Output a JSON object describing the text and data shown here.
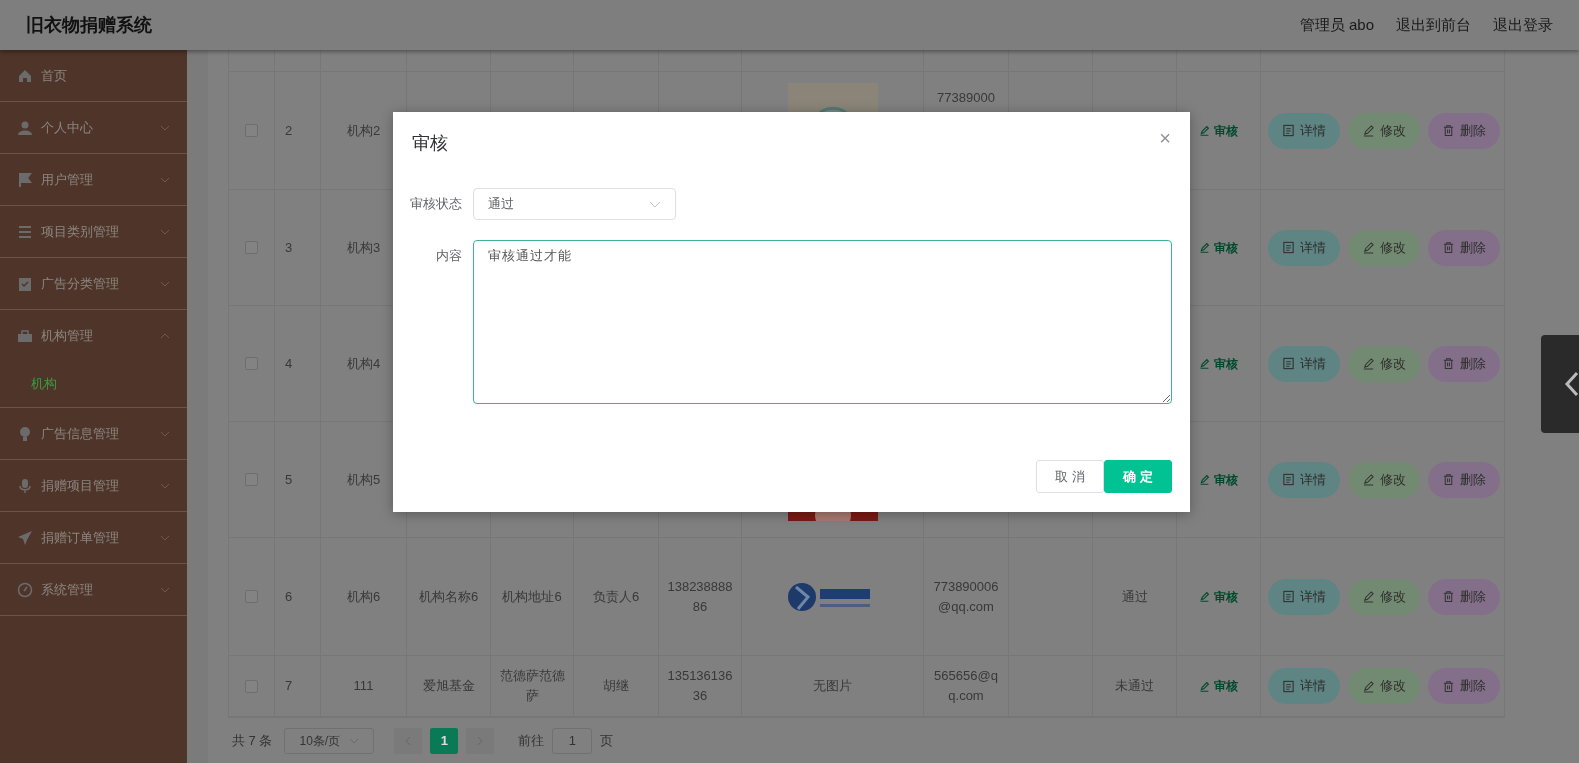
{
  "header": {
    "title": "旧衣物捐赠系统",
    "links": [
      "管理员 abo",
      "退出到前台",
      "退出登录"
    ]
  },
  "sidebar": {
    "items": [
      {
        "label": "首页"
      },
      {
        "label": "个人中心",
        "expanded": false
      },
      {
        "label": "用户管理",
        "expanded": false
      },
      {
        "label": "项目类别管理",
        "expanded": false
      },
      {
        "label": "广告分类管理",
        "expanded": false
      },
      {
        "label": "机构管理",
        "expanded": true,
        "children": [
          {
            "label": "机构",
            "selected": true
          }
        ]
      },
      {
        "label": "广告信息管理",
        "expanded": false
      },
      {
        "label": "捐赠项目管理",
        "expanded": false
      },
      {
        "label": "捐赠订单管理",
        "expanded": false
      },
      {
        "label": "系统管理",
        "expanded": false
      }
    ]
  },
  "table": {
    "rows": [
      {
        "checked": false,
        "cells": {
          "column_2": "2",
          "column_3": "机构2",
          "column_9": "77389000"
        },
        "audit": "审核",
        "buttons": [
          {
            "kind": "detail",
            "label": "详情"
          },
          {
            "kind": "edit",
            "label": "修改"
          },
          {
            "kind": "delete",
            "label": "删除"
          }
        ]
      },
      {
        "checked": false,
        "cells": {
          "column_2": "3",
          "column_3": "机构3"
        },
        "audit": "审核",
        "buttons": [
          {
            "kind": "detail",
            "label": "详情"
          },
          {
            "kind": "edit",
            "label": "修改"
          },
          {
            "kind": "delete",
            "label": "删除"
          }
        ]
      },
      {
        "checked": false,
        "cells": {
          "column_2": "4",
          "column_3": "机构4"
        },
        "audit": "审核",
        "buttons": [
          {
            "kind": "detail",
            "label": "详情"
          },
          {
            "kind": "edit",
            "label": "修改"
          },
          {
            "kind": "delete",
            "label": "删除"
          }
        ]
      },
      {
        "checked": false,
        "cells": {
          "column_2": "5",
          "column_3": "机构5"
        },
        "audit": "审核",
        "buttons": [
          {
            "kind": "detail",
            "label": "详情"
          },
          {
            "kind": "edit",
            "label": "修改"
          },
          {
            "kind": "delete",
            "label": "删除"
          }
        ]
      },
      {
        "checked": false,
        "cells": {
          "column_2": "6",
          "column_3": "机构6",
          "column_4": "机构名称6",
          "column_5": "机构地址6",
          "column_6": "负责人6",
          "column_7": "13823888886",
          "column_9": "773890006@qq.com",
          "column_11": "通过"
        },
        "audit": "审核",
        "buttons": [
          {
            "kind": "detail",
            "label": "详情"
          },
          {
            "kind": "edit",
            "label": "修改"
          },
          {
            "kind": "delete",
            "label": "删除"
          }
        ]
      },
      {
        "checked": false,
        "cells": {
          "column_2": "7",
          "column_3": "111",
          "column_4": "爱旭基金",
          "column_5": "范德萨范德萨",
          "column_6": "胡继",
          "column_7": "13513613636",
          "column_8": "无图片",
          "column_9": "565656@qq.com",
          "column_11": "未通过"
        },
        "audit": "审核",
        "buttons": [
          {
            "kind": "detail",
            "label": "详情"
          },
          {
            "kind": "edit",
            "label": "修改"
          },
          {
            "kind": "delete",
            "label": "删除"
          }
        ]
      }
    ]
  },
  "pagination": {
    "total": "共 7 条",
    "page_size": "10条/页",
    "pages": [
      {
        "label": "1",
        "selected": true
      }
    ],
    "goto_label": "前往",
    "goto_value": "1",
    "goto_suffix": "页"
  },
  "dialog": {
    "title": "审核",
    "close": "×",
    "fields": [
      {
        "kind": "select",
        "label": "审核状态",
        "value": "通过"
      },
      {
        "kind": "textarea",
        "label": "内容",
        "value": "审核通过才能"
      }
    ],
    "buttons": [
      {
        "kind": "cancel",
        "label": "取 消"
      },
      {
        "kind": "confirm",
        "label": "确 定"
      }
    ]
  }
}
